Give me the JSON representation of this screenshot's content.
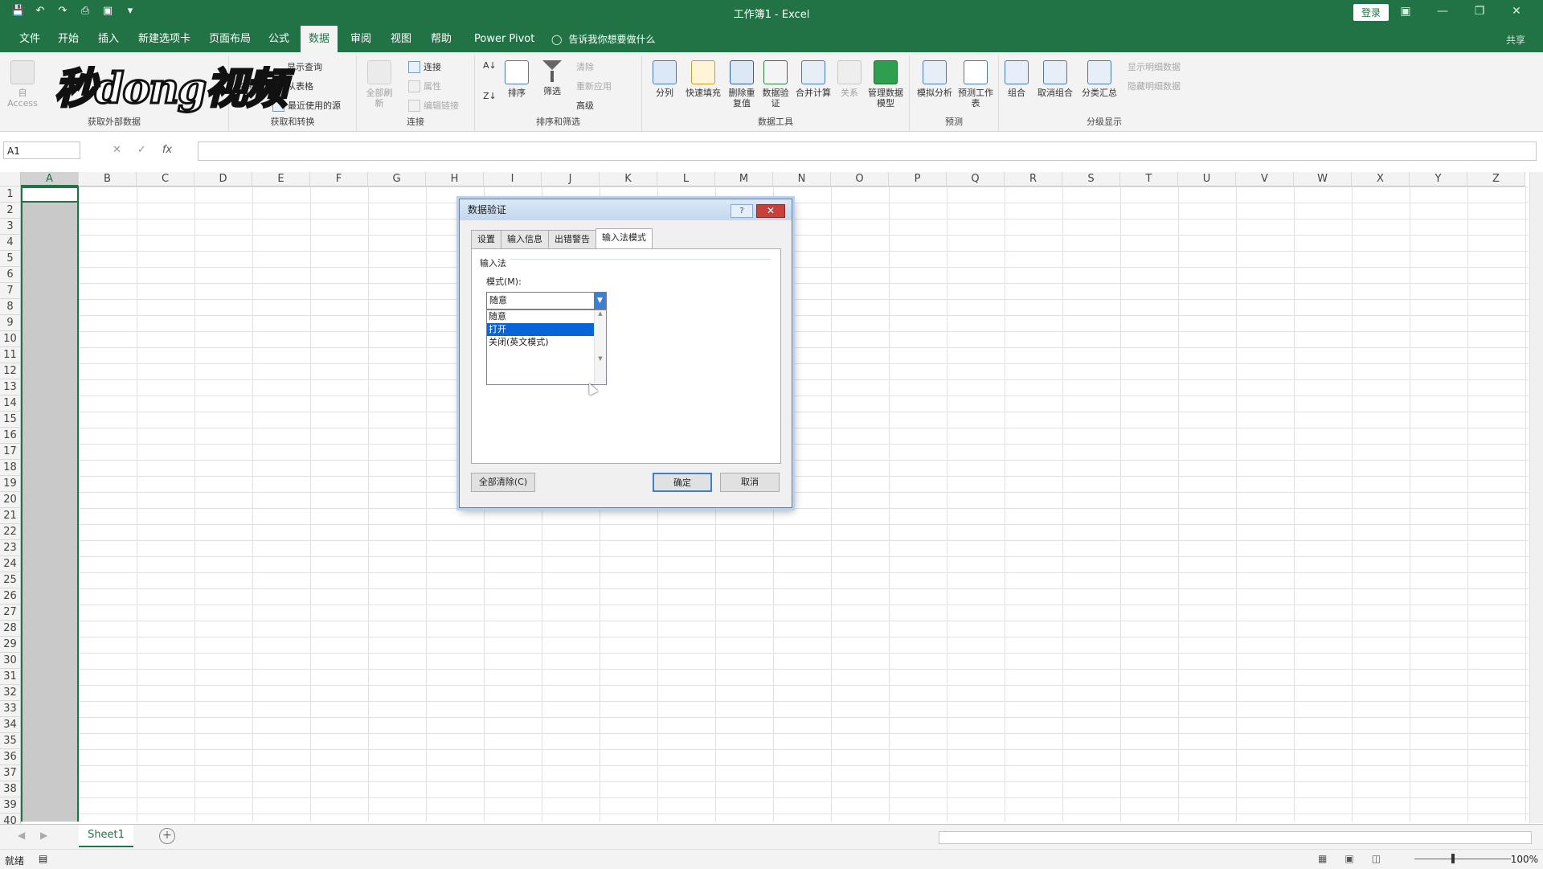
{
  "window": {
    "title": "工作簿1  -  Excel",
    "login_label": "登录",
    "share_label": "共享"
  },
  "menu": {
    "tabs": [
      "文件",
      "开始",
      "插入",
      "新建选项卡",
      "页面布局",
      "公式",
      "数据",
      "审阅",
      "视图",
      "帮助",
      "Power Pivot"
    ],
    "active": "数据",
    "tell_me": "告诉我你想要做什么"
  },
  "ribbon": {
    "groups": {
      "external": "获取外部数据",
      "transform": "获取和转换",
      "connections": "连接",
      "sort_filter": "排序和筛选",
      "data_tools": "数据工具",
      "forecast": "预测",
      "outline": "分级显示"
    },
    "access": "自 Access",
    "show_query": "显示查询",
    "from_table": "从表格",
    "recent_sources": "最近使用的源",
    "new_query": "查询",
    "refresh_all": "全部刷新",
    "connections": "连接",
    "properties": "属性",
    "edit_links": "编辑链接",
    "sort": "排序",
    "filter": "筛选",
    "clear": "清除",
    "reapply": "重新应用",
    "advanced": "高级",
    "split": "分列",
    "flash_fill": "快速填充",
    "remove_dup": "删除重复值",
    "validation": "数据验证",
    "consolidate": "合并计算",
    "relations": "关系",
    "data_model": "管理数据模型",
    "what_if": "模拟分析",
    "forecast_sheet": "预测工作表",
    "group": "组合",
    "ungroup": "取消组合",
    "subtotal": "分类汇总",
    "show_detail": "显示明细数据",
    "hide_detail": "隐藏明细数据"
  },
  "watermark": "秒dong视频",
  "formula_bar": {
    "name_box": "A1",
    "fx": "fx"
  },
  "columns": [
    "A",
    "B",
    "C",
    "D",
    "E",
    "F",
    "G",
    "H",
    "I",
    "J",
    "K",
    "L",
    "M",
    "N",
    "O",
    "P",
    "Q",
    "R",
    "S",
    "T",
    "U",
    "V",
    "W",
    "X",
    "Y",
    "Z"
  ],
  "rows": [
    "1",
    "2",
    "3",
    "4",
    "5",
    "6",
    "7",
    "8",
    "9",
    "10",
    "11",
    "12",
    "13",
    "14",
    "15",
    "16",
    "17",
    "18",
    "19",
    "20",
    "21",
    "22",
    "23",
    "24",
    "25",
    "26",
    "27",
    "28",
    "29",
    "30",
    "31",
    "32",
    "33",
    "34",
    "35",
    "36",
    "37",
    "38",
    "39",
    "40"
  ],
  "sheet_tab": "Sheet1",
  "status": {
    "ready": "就绪",
    "zoom": "100%"
  },
  "dialog": {
    "title": "数据验证",
    "tabs": [
      "设置",
      "输入信息",
      "出错警告",
      "输入法模式"
    ],
    "active_tab": "输入法模式",
    "section": "输入法",
    "mode_label": "模式(M):",
    "mode_value": "随意",
    "options": [
      "随意",
      "打开",
      "关闭(英文模式)"
    ],
    "highlighted": "打开",
    "clear_all": "全部清除(C)",
    "ok": "确定",
    "cancel": "取消"
  }
}
